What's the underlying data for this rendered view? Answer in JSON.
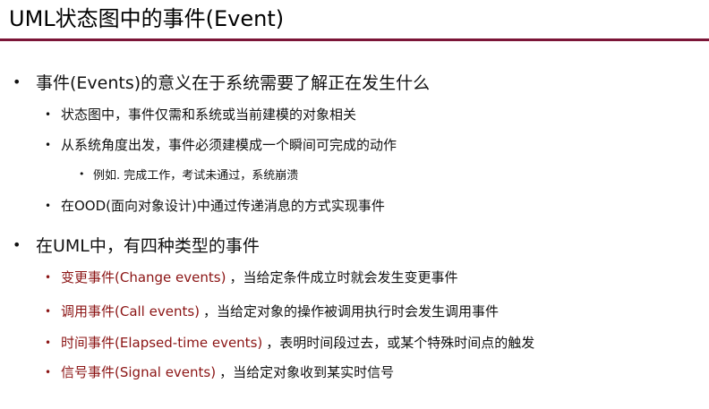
{
  "header": {
    "title": "UML状态图中的事件(Event)"
  },
  "colors": {
    "accent_rule": "#7b1537",
    "event_type_red": "#8b1414"
  },
  "bullets": {
    "b1": {
      "text": "事件(Events)的意义在于系统需要了解正在发生什么",
      "sub1": "状态图中，事件仅需和系统或当前建模的对象相关",
      "sub2": "从系统角度出发，事件必须建模成一个瞬间可完成的动作",
      "sub2_example": "例如. 完成工作，考试未通过，系统崩溃",
      "sub3": "在OOD(面向对象设计)中通过传递消息的方式实现事件"
    },
    "b2": {
      "text": "在UML中，有四种类型的事件",
      "change_name": "变更事件(Change events)",
      "change_desc": "，当给定条件成立时就会发生变更事件",
      "call_name": "调用事件(Call events)",
      "call_desc": "，当给定对象的操作被调用执行时会发生调用事件",
      "time_name": "时间事件(Elapsed-time events)",
      "time_desc": "，表明时间段过去，或某个特殊时间点的触发",
      "signal_name": "信号事件(Signal events)",
      "signal_desc": "，当给定对象收到某实时信号"
    }
  }
}
